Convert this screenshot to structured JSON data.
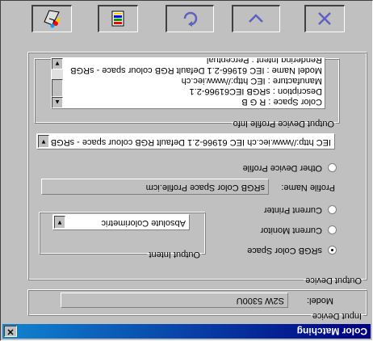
{
  "window": {
    "title": "Color Matching",
    "close_glyph": "✕"
  },
  "input_device": {
    "legend": "Input Device",
    "model_label": "Model:",
    "model_value": "S2W 5300U"
  },
  "output_device": {
    "legend": "Output Device",
    "options": [
      {
        "label": "sRGB Color Space",
        "selected": true
      },
      {
        "label": "Current Monitor",
        "selected": false
      },
      {
        "label": "Current Printer",
        "selected": false
      },
      {
        "label": "Other Device Profile",
        "selected": false
      }
    ],
    "output_intent": {
      "legend": "Output Intent",
      "selected": "Absolute Colorimetric"
    },
    "profile_name_label": "Profile Name:",
    "profile_name_value": "sRGB Color Space Profile.icm",
    "profile_dropdown_value": "IEC http://www.iec.ch IEC 61966-2.1 Default RGB colour space - sRGB",
    "profile_info": {
      "legend": "Output Device Profile Info",
      "lines": [
        "Color Space : R G B",
        "Description : sRGB IEC61966-2.1",
        "Manufacture : IEC http://www.iec.ch",
        "Model Name : IEC 61966-2.1 Default RGB colour space - sRGB",
        "Rendering Intent : Perceptual"
      ]
    }
  },
  "toolbar": {
    "buttons": [
      {
        "name": "close",
        "icon": "x-icon",
        "color": "#6060c0"
      },
      {
        "name": "collapse",
        "icon": "chevron-up-icon",
        "color": "#6060c0"
      },
      {
        "name": "refresh",
        "icon": "refresh-icon",
        "color": "#6060c0"
      },
      {
        "name": "profile-info",
        "icon": "color-profile-icon"
      },
      {
        "name": "color-print",
        "icon": "color-print-icon"
      }
    ]
  },
  "colors": {
    "titlebar_start": "#000080",
    "titlebar_end": "#1084d0",
    "face": "#c0c0c0"
  }
}
